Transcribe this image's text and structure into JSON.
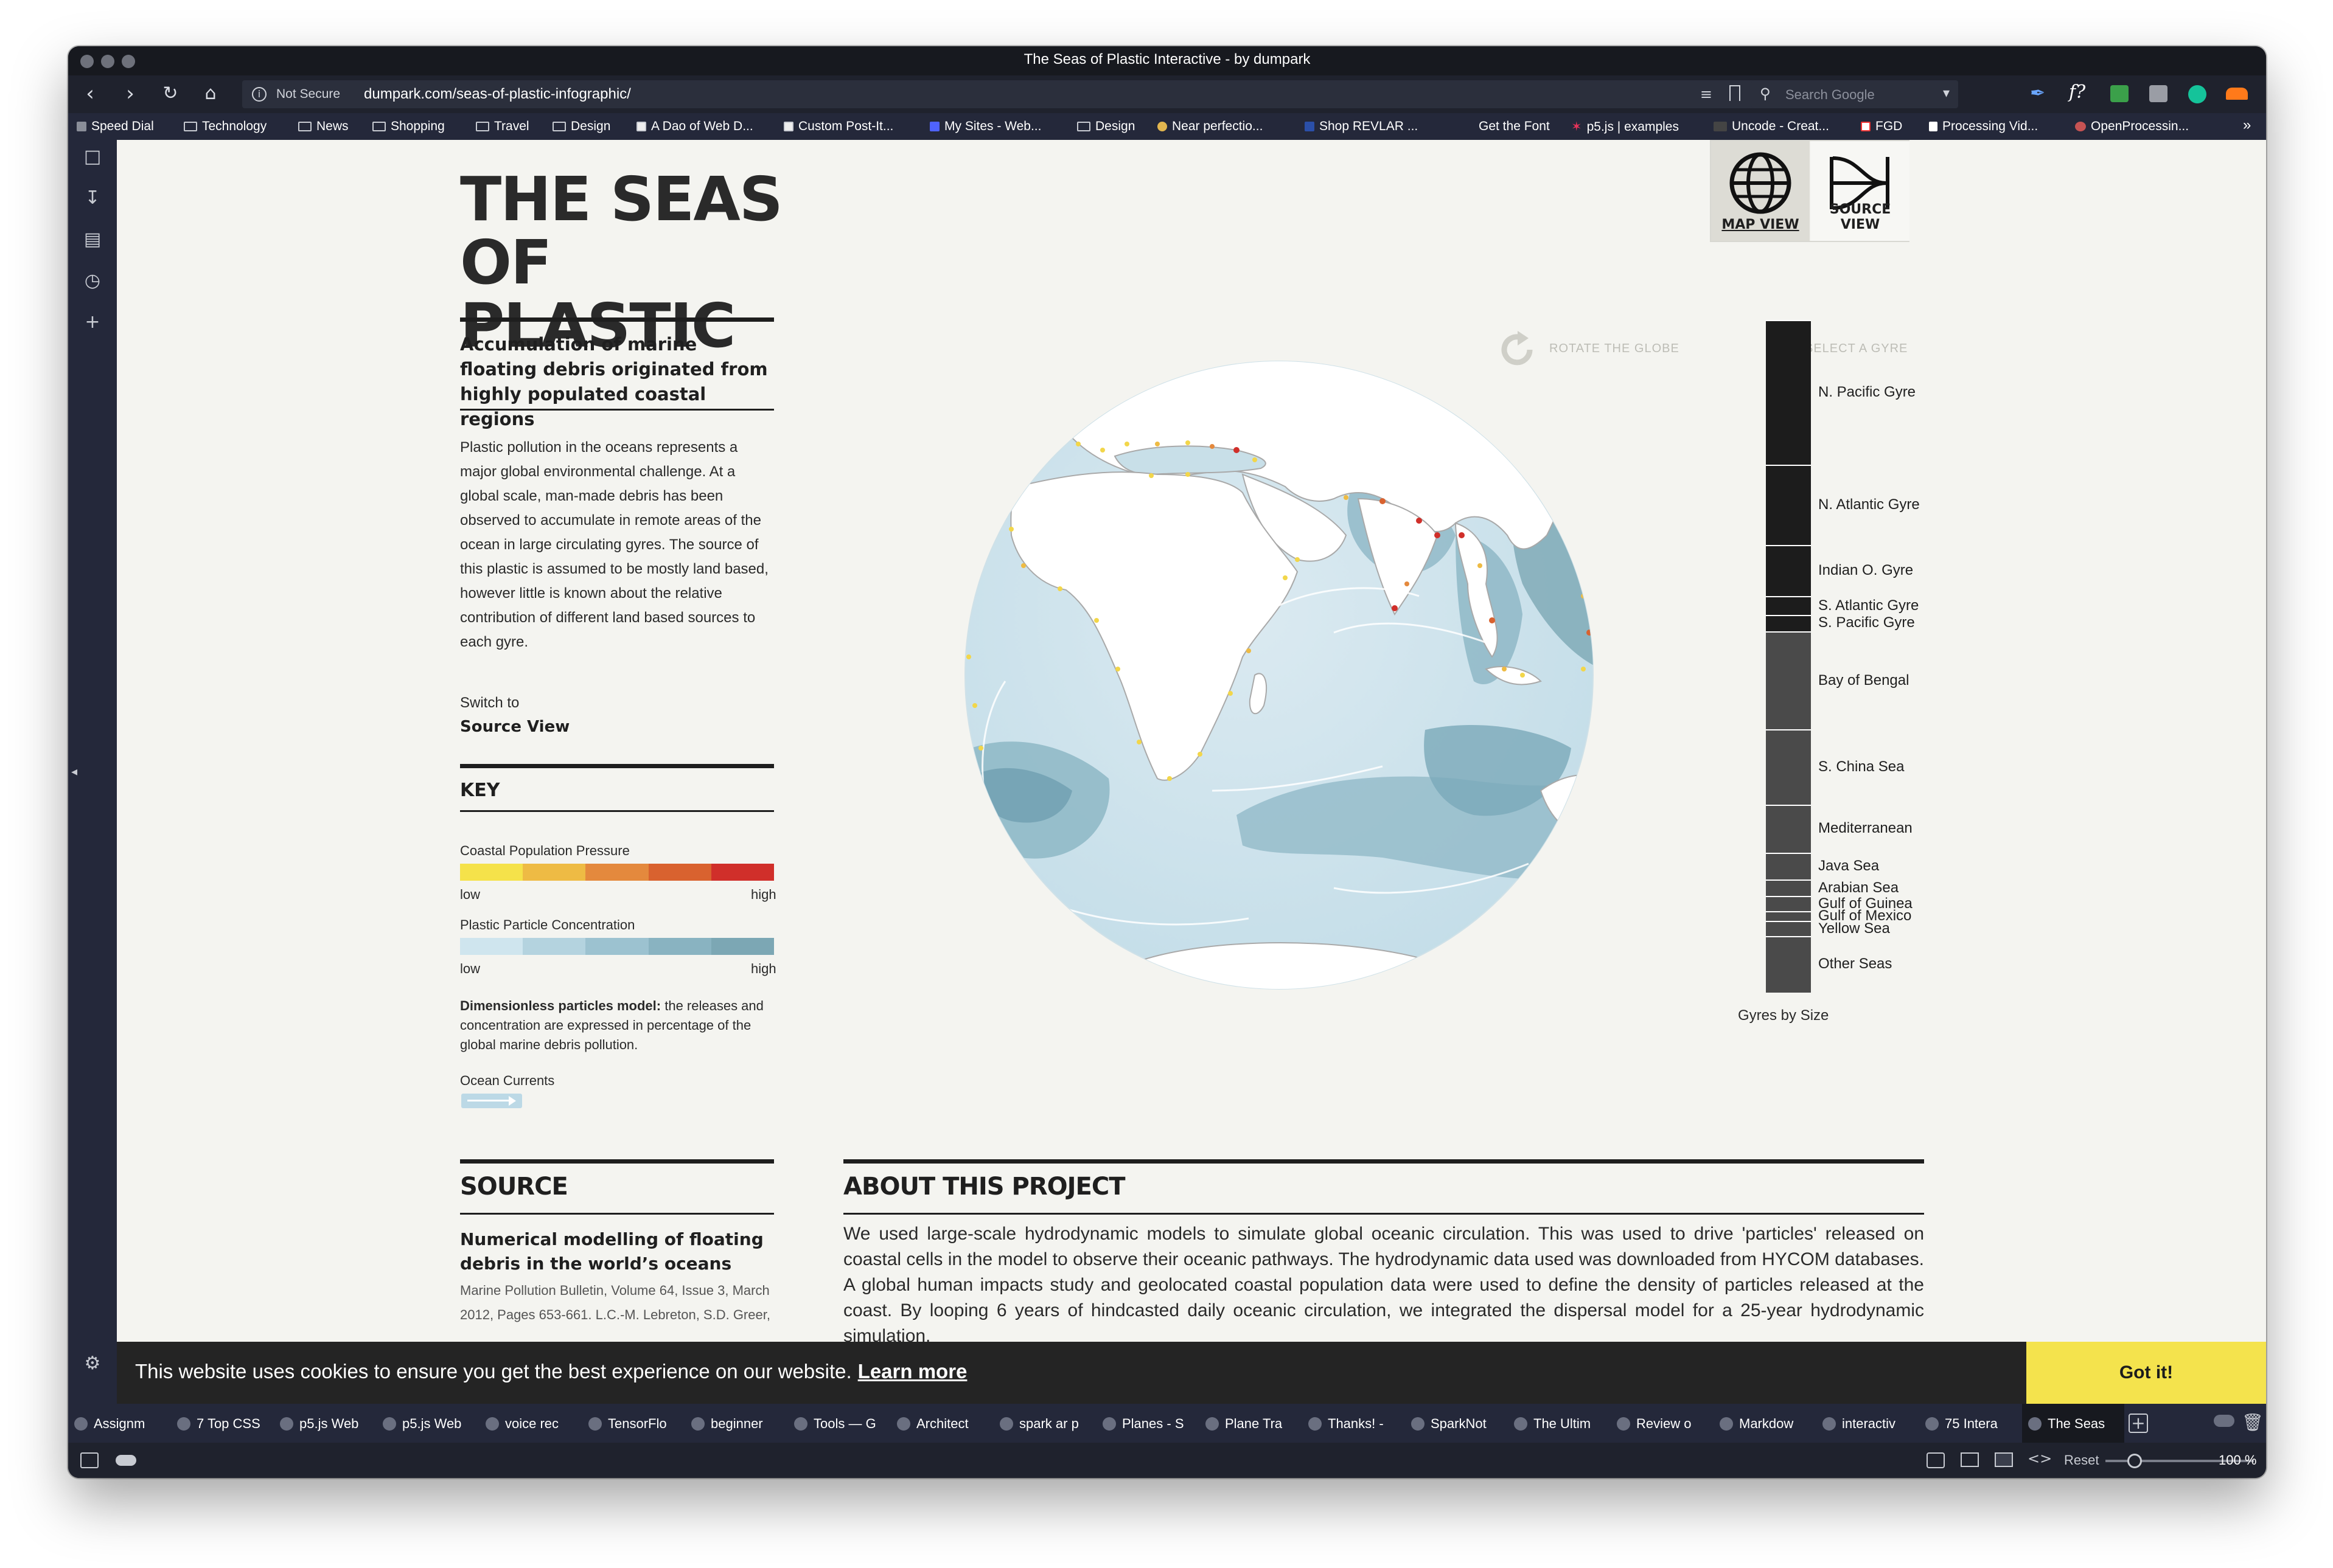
{
  "browser": {
    "window_title": "The Seas of Plastic Interactive - by dumpark",
    "not_secure": "Not Secure",
    "url": "dumpark.com/seas-of-plastic-infographic/",
    "search_placeholder": "Search Google",
    "bookmarks": [
      "Speed Dial",
      "Technology",
      "News",
      "Shopping",
      "Travel",
      "Design",
      "A Dao of Web D...",
      "Custom Post-It...",
      "My Sites - Web...",
      "Design",
      "Near perfectio...",
      "Shop REVLAR ...",
      "Get the Font",
      "p5.js | examples",
      "Uncode - Creat...",
      "FGD",
      "Processing Vid...",
      "OpenProcessin..."
    ],
    "tabs": [
      "Assignm",
      "7 Top CSS",
      "p5.js Web",
      "p5.js Web",
      "voice rec",
      "TensorFlo",
      "beginner",
      "Tools — G",
      "Architect",
      "spark ar p",
      "Planes - S",
      "Plane Tra",
      "Thanks! -",
      "SparkNot",
      "The Ultim",
      "Review o",
      "Markdow",
      "interactiv",
      "75 Intera",
      "The Seas"
    ],
    "status": {
      "reset": "Reset",
      "zoom": "100 %"
    }
  },
  "page": {
    "title_line1": "THE SEAS OF",
    "title_line2": "PLASTIC",
    "subtitle": "Accumulation of marine floating debris originated from highly populated coastal regions",
    "intro": "Plastic pollution in the oceans represents a major global environmental challenge. At a global scale, man-made debris has been observed to accumulate in remote areas of the ocean in large circulating gyres. The source of this plastic is assumed to be mostly land based, however little is known about the relative contribution of different land based sources to each gyre.",
    "switch_label": "Switch to",
    "switch_link": "Source View",
    "key": {
      "title": "KEY",
      "coastal_label": "Coastal Population Pressure",
      "coastal_colors": [
        "#f5e24a",
        "#eebb44",
        "#e4893d",
        "#d9622f",
        "#d02f2a"
      ],
      "particle_label": "Plastic Particle Concentration",
      "particle_colors": [
        "#cfe5ee",
        "#b4d3df",
        "#9cc2d0",
        "#89b3c1",
        "#7ca7b4"
      ],
      "low": "low",
      "high": "high",
      "dimless_bold": "Dimensionless particles model:",
      "dimless_text": " the releases and concentration are expressed in percentage of the global marine debris pollution.",
      "currents_label": "Ocean Currents"
    },
    "source": {
      "title": "SOURCE",
      "heading": "Numerical modelling of floating debris in the world’s oceans",
      "body": "Marine Pollution Bulletin, Volume 64, Issue 3, March 2012, Pages 653-661. L.C.-M. Lebreton, S.D. Greer,"
    },
    "about": {
      "title": "ABOUT THIS PROJECT",
      "body": "We used large-scale hydrodynamic models to simulate global oceanic circulation. This was used to drive 'particles' released on coastal cells in the model to observe their oceanic pathways. The hydrodynamic data used was downloaded from HYCOM databases. A global human impacts study and geolocated coastal population data were used to define the density of particles released at the coast. By looping 6 years of hindcasted daily oceanic circulation, we integrated the dispersal model for a 25-year hydrodynamic simulation."
    },
    "views": {
      "map": "MAP VIEW",
      "source": "SOURCE VIEW"
    },
    "hints": {
      "rotate": "ROTATE THE GLOBE",
      "select": "SELECT A GYRE"
    },
    "gyres": [
      {
        "name": "N. Pacific Gyre",
        "share": 8.7,
        "color": "#1c1c1c"
      },
      {
        "name": "N. Atlantic Gyre",
        "share": 4.8,
        "color": "#1c1c1c"
      },
      {
        "name": "Indian O. Gyre",
        "share": 3.1,
        "color": "#1c1c1c"
      },
      {
        "name": "S. Atlantic Gyre",
        "share": 1.1,
        "color": "#1c1c1c"
      },
      {
        "name": "S. Pacific Gyre",
        "share": 1.0,
        "color": "#1c1c1c"
      },
      {
        "name": "Bay of Bengal",
        "share": 5.9,
        "color": "#4a4a4a"
      },
      {
        "name": "S. China Sea",
        "share": 4.5,
        "color": "#4a4a4a"
      },
      {
        "name": "Mediterranean",
        "share": 2.9,
        "color": "#4a4a4a"
      },
      {
        "name": "Java Sea",
        "share": 1.6,
        "color": "#4a4a4a"
      },
      {
        "name": "Arabian Sea",
        "share": 1.0,
        "color": "#4a4a4a"
      },
      {
        "name": "Gulf of Guinea",
        "share": 0.9,
        "color": "#4a4a4a"
      },
      {
        "name": "Gulf of Mexico",
        "share": 0.6,
        "color": "#4a4a4a"
      },
      {
        "name": "Yellow Sea",
        "share": 0.9,
        "color": "#4a4a4a"
      },
      {
        "name": "Other Seas",
        "share": 3.4,
        "color": "#4a4a4a"
      }
    ],
    "gyres_caption": "Gyres by Size"
  },
  "cookie": {
    "text": "This website uses cookies to ensure you get the best experience on our website.",
    "learn_more": "Learn more",
    "ok": "Got it!"
  }
}
